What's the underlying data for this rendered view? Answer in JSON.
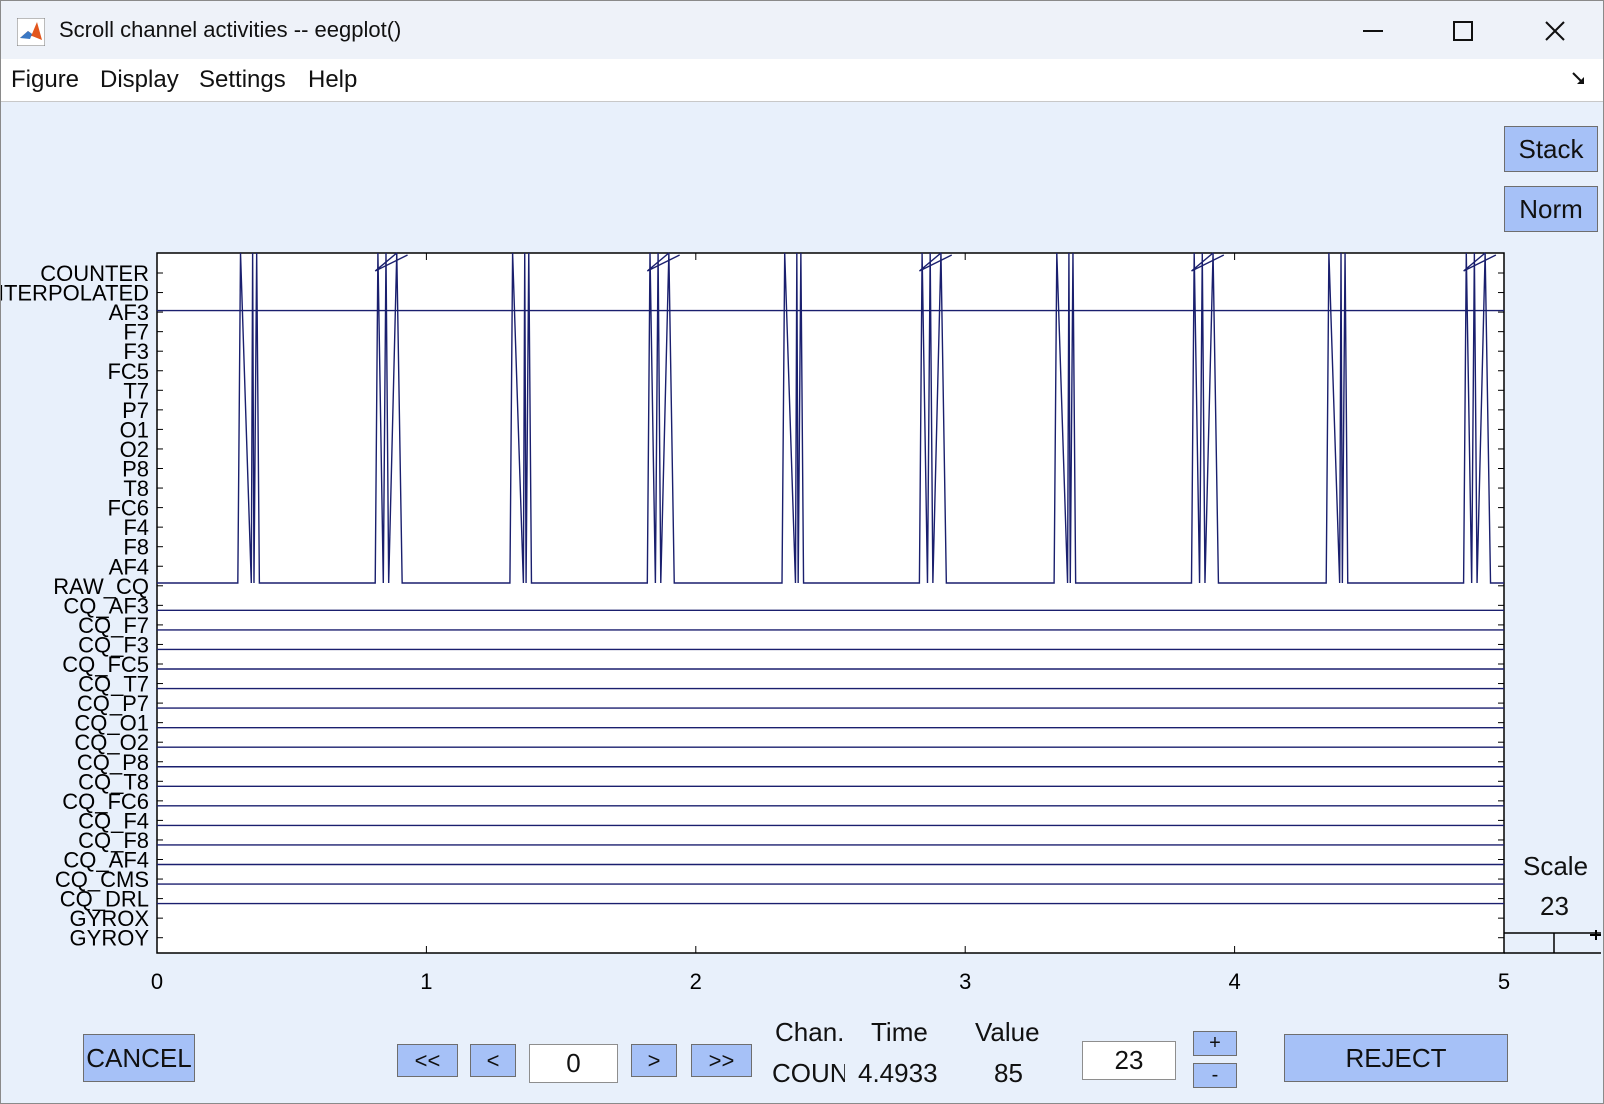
{
  "window": {
    "title": "Scroll channel activities -- eegplot()",
    "icon": "matlab-icon"
  },
  "menus": [
    "Figure",
    "Display",
    "Settings",
    "Help"
  ],
  "right_buttons": {
    "stack": "Stack",
    "norm": "Norm"
  },
  "chart_data": {
    "type": "line",
    "channels": [
      "COUNTER",
      "INTERPOLATED",
      "AF3",
      "F7",
      "F3",
      "FC5",
      "T7",
      "P7",
      "O1",
      "O2",
      "P8",
      "T8",
      "FC6",
      "F4",
      "F8",
      "AF4",
      "RAW_CQ",
      "CQ_AF3",
      "CQ_F7",
      "CQ_F3",
      "CQ_FC5",
      "CQ_T7",
      "CQ_P7",
      "CQ_O1",
      "CQ_O2",
      "CQ_P8",
      "CQ_T8",
      "CQ_FC6",
      "CQ_F4",
      "CQ_F8",
      "CQ_AF4",
      "CQ_CMS",
      "CQ_DRL",
      "GYROX",
      "GYROY"
    ],
    "xticks": [
      "0",
      "1",
      "2",
      "3",
      "4",
      "5"
    ],
    "xlim": [
      0,
      5
    ],
    "line_color": "#1a1f6e"
  },
  "scale": {
    "label": "Scale",
    "value": "23"
  },
  "bottom": {
    "cancel": "CANCEL",
    "nav_first": "<<",
    "nav_prev": "<",
    "time_input": "0",
    "nav_next": ">",
    "nav_last": ">>",
    "chan_header": "Chan.",
    "time_header": "Time",
    "value_header": "Value",
    "chan_value": "COUN",
    "time_value": "4.4933",
    "value_value": "85",
    "scale_input": "23",
    "plus": "+",
    "minus": "-",
    "reject": "REJECT"
  }
}
